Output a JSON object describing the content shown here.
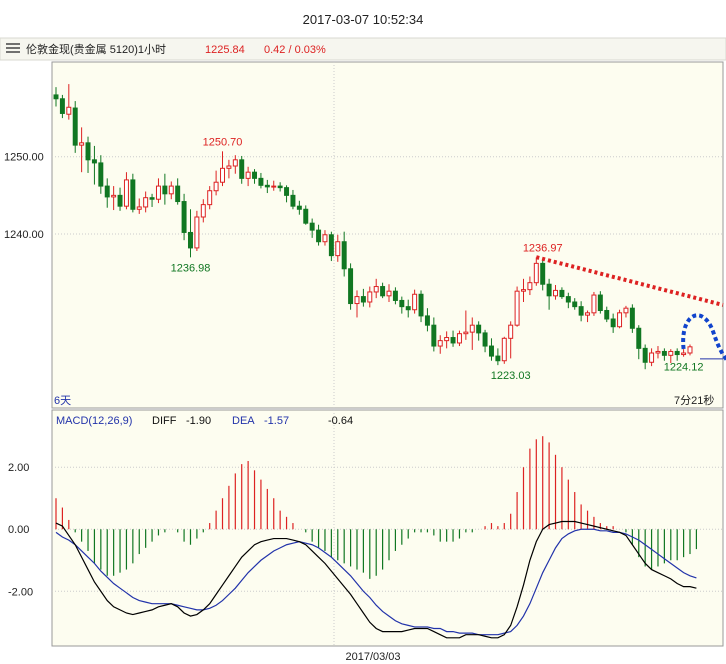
{
  "header": {
    "timestamp": "2017-03-07 10:52:34",
    "instrument": "伦敦金现(贵金属 5120)1小时",
    "price": "1225.84",
    "change": "0.42 / 0.03%"
  },
  "colors": {
    "up": "#dd2222",
    "down": "#117722",
    "grid": "#cccccc",
    "panel_bg": "#fdfdf0",
    "diff_line": "#000000",
    "dea_line": "#2233aa",
    "trend_line": "#dd2222",
    "forecast_arrow": "#1144cc"
  },
  "chart_data": [
    {
      "type": "candlestick",
      "ylim": [
        1218,
        1262
      ],
      "yticks": [
        1240.0,
        1250.0
      ],
      "ytick_labels": [
        "1240.00",
        "1250.00"
      ],
      "period_label": "6天",
      "countdown_label": "7分21秒",
      "x_label": "2017/03/03",
      "annotations": [
        {
          "label": "1250.70",
          "bar": 26,
          "value": 1250.7,
          "color": "up"
        },
        {
          "label": "1236.98",
          "bar": 21,
          "value": 1236.98,
          "color": "down"
        },
        {
          "label": "1223.03",
          "bar": 71,
          "value": 1223.03,
          "color": "down"
        },
        {
          "label": "1236.97",
          "bar": 76,
          "value": 1236.97,
          "color": "up"
        },
        {
          "label": "1224.12",
          "bar": 98,
          "value": 1224.12,
          "color": "down"
        }
      ],
      "trendline": {
        "from": {
          "bar": 75,
          "value": 1237.0
        },
        "to": {
          "bar": 100,
          "value": 1231.7
        }
      },
      "forecast": {
        "bar_start": 98,
        "value_start": 1224.6
      },
      "candles": [
        [
          1258,
          1259,
          1256.5,
          1257.5
        ],
        [
          1257.5,
          1258,
          1255,
          1255.6
        ],
        [
          1255.5,
          1259.4,
          1254.8,
          1256.4
        ],
        [
          1256.3,
          1257.2,
          1250.5,
          1251.5
        ],
        [
          1251.5,
          1253.8,
          1248,
          1251.8
        ],
        [
          1251.8,
          1252.6,
          1247.9,
          1249.6
        ],
        [
          1249.6,
          1251.4,
          1246.4,
          1249.2
        ],
        [
          1249.2,
          1250.2,
          1245.2,
          1246.2
        ],
        [
          1246.2,
          1247.2,
          1243.4,
          1244.8
        ],
        [
          1244.8,
          1246.2,
          1243.1,
          1245
        ],
        [
          1245,
          1246,
          1243,
          1243.6
        ],
        [
          1243.6,
          1248,
          1243.2,
          1247
        ],
        [
          1247,
          1247.8,
          1242.8,
          1243.2
        ],
        [
          1243.2,
          1244.6,
          1242.6,
          1243.5
        ],
        [
          1243.5,
          1245.5,
          1242.8,
          1244.7
        ],
        [
          1244.7,
          1245.2,
          1243.5,
          1244.5
        ],
        [
          1244.5,
          1247.2,
          1244,
          1246.2
        ],
        [
          1246.2,
          1247.8,
          1243.8,
          1245.2
        ],
        [
          1245.2,
          1246.8,
          1244.5,
          1246.2
        ],
        [
          1246.2,
          1247.2,
          1243.8,
          1244.2
        ],
        [
          1244.2,
          1245.2,
          1239.2,
          1240.2
        ],
        [
          1240.2,
          1243.2,
          1236.98,
          1238.2
        ],
        [
          1238.2,
          1243,
          1237.8,
          1242.2
        ],
        [
          1242.2,
          1244.5,
          1241.5,
          1243.8
        ],
        [
          1243.8,
          1246.2,
          1243.2,
          1245.6
        ],
        [
          1245.6,
          1248.2,
          1245,
          1246.7
        ],
        [
          1246.7,
          1250.7,
          1246.2,
          1248.5
        ],
        [
          1248.5,
          1249.6,
          1247.2,
          1248.8
        ],
        [
          1248.8,
          1250.2,
          1247.8,
          1249.6
        ],
        [
          1249.6,
          1250.1,
          1246.5,
          1247.2
        ],
        [
          1247.2,
          1248.7,
          1246.2,
          1248
        ],
        [
          1248,
          1248.4,
          1246.5,
          1247.2
        ],
        [
          1247.2,
          1247.9,
          1245.9,
          1246.3
        ],
        [
          1246.3,
          1247,
          1245.3,
          1246.1
        ],
        [
          1246.1,
          1246.9,
          1245.6,
          1246.2
        ],
        [
          1246.2,
          1246.7,
          1245.5,
          1246.0
        ],
        [
          1246.0,
          1246.3,
          1244.1,
          1245
        ],
        [
          1245,
          1245.7,
          1243.2,
          1243.6
        ],
        [
          1243.6,
          1244.3,
          1242.5,
          1243.2
        ],
        [
          1243.2,
          1243.7,
          1241.2,
          1241.4
        ],
        [
          1241.4,
          1242,
          1239.5,
          1240.5
        ],
        [
          1240.5,
          1241.2,
          1238.5,
          1239
        ],
        [
          1239,
          1240.5,
          1238.5,
          1239.9
        ],
        [
          1239.9,
          1240.3,
          1236.5,
          1237.2
        ],
        [
          1237.2,
          1239.9,
          1236.4,
          1239
        ],
        [
          1239,
          1240.3,
          1234.5,
          1235.5
        ],
        [
          1235.5,
          1236.2,
          1230.2,
          1231
        ],
        [
          1231,
          1232.7,
          1229.2,
          1231.9
        ],
        [
          1231.9,
          1232.9,
          1230.6,
          1231.2
        ],
        [
          1231.2,
          1233.2,
          1230.5,
          1232.5
        ],
        [
          1232.5,
          1234.2,
          1231.7,
          1233.2
        ],
        [
          1233.2,
          1233.7,
          1231.7,
          1232
        ],
        [
          1232,
          1233.5,
          1231.2,
          1232.6
        ],
        [
          1232.6,
          1233.1,
          1230.9,
          1231.4
        ],
        [
          1231.4,
          1231.9,
          1229.7,
          1230.6
        ],
        [
          1230.6,
          1231.5,
          1229.2,
          1230.2
        ],
        [
          1230.2,
          1232.8,
          1229.7,
          1232.2
        ],
        [
          1232.2,
          1232.7,
          1228.6,
          1229.4
        ],
        [
          1229.4,
          1230.4,
          1227.4,
          1228.2
        ],
        [
          1228.2,
          1229.2,
          1224.8,
          1225.5
        ],
        [
          1225.5,
          1226.9,
          1224.5,
          1226.2
        ],
        [
          1226.2,
          1227.4,
          1225.2,
          1226.6
        ],
        [
          1226.6,
          1227.5,
          1225.4,
          1225.9
        ],
        [
          1225.9,
          1227.5,
          1225.5,
          1227.1
        ],
        [
          1227.1,
          1230.1,
          1226.3,
          1227.3
        ],
        [
          1227.3,
          1229.2,
          1225,
          1228.2
        ],
        [
          1228.2,
          1228.7,
          1226.2,
          1227.2
        ],
        [
          1227.2,
          1227.6,
          1224.7,
          1225.5
        ],
        [
          1225.5,
          1226.5,
          1223.6,
          1224.2
        ],
        [
          1224.2,
          1225.2,
          1223.03,
          1223.6
        ],
        [
          1223.6,
          1226.7,
          1223.2,
          1226.5
        ],
        [
          1226.5,
          1228.7,
          1223.9,
          1228.2
        ],
        [
          1228.2,
          1233.2,
          1228,
          1232.6
        ],
        [
          1232.6,
          1234.2,
          1231.2,
          1232.8
        ],
        [
          1232.8,
          1234.5,
          1232.1,
          1233.7
        ],
        [
          1233.7,
          1236.97,
          1233.3,
          1236.2
        ],
        [
          1236.2,
          1236.7,
          1232.7,
          1233.5
        ],
        [
          1233.5,
          1234.2,
          1230.2,
          1232
        ],
        [
          1232,
          1233.4,
          1231.5,
          1232.7
        ],
        [
          1232.7,
          1233.1,
          1231.6,
          1231.9
        ],
        [
          1231.9,
          1232.4,
          1230.4,
          1231.2
        ],
        [
          1231.2,
          1231.7,
          1230.2,
          1230.6
        ],
        [
          1230.6,
          1231.3,
          1228.7,
          1229.5
        ],
        [
          1229.5,
          1230.1,
          1228.6,
          1229.8
        ],
        [
          1229.8,
          1232.5,
          1229.4,
          1232.1
        ],
        [
          1232.1,
          1232.6,
          1229.7,
          1230.1
        ],
        [
          1230.1,
          1230.6,
          1228.6,
          1229
        ],
        [
          1229,
          1229.7,
          1227.2,
          1228
        ],
        [
          1228,
          1230.2,
          1227.8,
          1229.8
        ],
        [
          1229.8,
          1230.7,
          1229.2,
          1230.4
        ],
        [
          1230.4,
          1230.9,
          1227.2,
          1227.8
        ],
        [
          1227.8,
          1228.2,
          1223.8,
          1225.2
        ],
        [
          1225.2,
          1225.7,
          1222.5,
          1223.4
        ],
        [
          1223.4,
          1225.2,
          1222.9,
          1224.6
        ],
        [
          1224.6,
          1225.5,
          1223.9,
          1224.8
        ],
        [
          1224.8,
          1225.2,
          1223.6,
          1224.3
        ],
        [
          1224.3,
          1225.1,
          1223.3,
          1224.8
        ],
        [
          1224.8,
          1225.2,
          1223.6,
          1224.4
        ],
        [
          1224.4,
          1225.1,
          1224.12,
          1224.6
        ],
        [
          1224.6,
          1225.7,
          1224.3,
          1225.4
        ]
      ]
    },
    {
      "type": "macd",
      "label": "MACD(12,26,9)",
      "diff_label": "DIFF",
      "diff_value": "-1.90",
      "dea_label": "DEA",
      "dea_value": "-1.57",
      "hist_value": "-0.64",
      "ylim": [
        -3.7,
        3.2
      ],
      "yticks": [
        2.0,
        0.0,
        -2.0
      ],
      "ytick_labels": [
        "2.00",
        "0.00",
        "-2.00"
      ],
      "diff": [
        0.2,
        0.1,
        -0.2,
        -0.5,
        -0.9,
        -1.3,
        -1.7,
        -2.0,
        -2.3,
        -2.5,
        -2.6,
        -2.7,
        -2.75,
        -2.7,
        -2.65,
        -2.6,
        -2.5,
        -2.45,
        -2.4,
        -2.5,
        -2.7,
        -2.8,
        -2.75,
        -2.6,
        -2.4,
        -2.1,
        -1.8,
        -1.5,
        -1.2,
        -0.9,
        -0.7,
        -0.5,
        -0.4,
        -0.35,
        -0.3,
        -0.3,
        -0.3,
        -0.35,
        -0.4,
        -0.5,
        -0.7,
        -0.9,
        -1.1,
        -1.35,
        -1.6,
        -1.85,
        -2.1,
        -2.4,
        -2.7,
        -3.0,
        -3.2,
        -3.3,
        -3.3,
        -3.3,
        -3.3,
        -3.25,
        -3.2,
        -3.2,
        -3.2,
        -3.3,
        -3.4,
        -3.5,
        -3.5,
        -3.5,
        -3.4,
        -3.4,
        -3.4,
        -3.45,
        -3.5,
        -3.5,
        -3.4,
        -3.1,
        -2.5,
        -1.8,
        -1.0,
        -0.4,
        0.0,
        0.15,
        0.2,
        0.25,
        0.25,
        0.25,
        0.2,
        0.15,
        0.1,
        0.05,
        0.0,
        -0.05,
        -0.1,
        -0.2,
        -0.5,
        -0.8,
        -1.1,
        -1.3,
        -1.4,
        -1.5,
        -1.6,
        -1.75,
        -1.85,
        -1.85,
        -1.9
      ],
      "dea": [
        -0.1,
        -0.25,
        -0.35,
        -0.5,
        -0.7,
        -0.9,
        -1.1,
        -1.35,
        -1.55,
        -1.75,
        -1.9,
        -2.05,
        -2.2,
        -2.3,
        -2.35,
        -2.4,
        -2.4,
        -2.4,
        -2.4,
        -2.45,
        -2.5,
        -2.55,
        -2.6,
        -2.6,
        -2.55,
        -2.45,
        -2.3,
        -2.1,
        -1.9,
        -1.65,
        -1.4,
        -1.2,
        -1.0,
        -0.85,
        -0.7,
        -0.6,
        -0.5,
        -0.45,
        -0.4,
        -0.45,
        -0.5,
        -0.6,
        -0.75,
        -0.9,
        -1.1,
        -1.3,
        -1.5,
        -1.75,
        -2.0,
        -2.2,
        -2.45,
        -2.65,
        -2.8,
        -2.95,
        -3.05,
        -3.1,
        -3.15,
        -3.15,
        -3.15,
        -3.2,
        -3.2,
        -3.3,
        -3.3,
        -3.35,
        -3.35,
        -3.35,
        -3.4,
        -3.4,
        -3.4,
        -3.4,
        -3.35,
        -3.3,
        -3.1,
        -2.8,
        -2.4,
        -1.9,
        -1.4,
        -1.0,
        -0.6,
        -0.3,
        -0.15,
        -0.05,
        0.0,
        0.0,
        0.0,
        -0.05,
        -0.05,
        -0.1,
        -0.1,
        -0.15,
        -0.25,
        -0.35,
        -0.5,
        -0.65,
        -0.8,
        -0.95,
        -1.1,
        -1.25,
        -1.4,
        -1.5,
        -1.57
      ],
      "hist": [
        1.0,
        0.7,
        0.3,
        -0.1,
        -0.4,
        -0.7,
        -1.1,
        -1.3,
        -1.5,
        -1.5,
        -1.4,
        -1.3,
        -1.1,
        -0.8,
        -0.6,
        -0.4,
        -0.2,
        -0.1,
        0.0,
        -0.1,
        -0.4,
        -0.5,
        -0.3,
        -0.1,
        0.2,
        0.6,
        1.0,
        1.4,
        1.8,
        2.1,
        2.2,
        1.9,
        1.6,
        1.3,
        1.0,
        0.6,
        0.4,
        0.2,
        0.0,
        -0.1,
        -0.4,
        -0.6,
        -0.7,
        -0.9,
        -1.0,
        -1.1,
        -1.2,
        -1.3,
        -1.4,
        -1.6,
        -1.5,
        -1.3,
        -1.0,
        -0.7,
        -0.5,
        -0.3,
        -0.1,
        -0.1,
        -0.1,
        -0.2,
        -0.4,
        -0.4,
        -0.4,
        -0.3,
        -0.1,
        -0.1,
        0.0,
        0.1,
        0.2,
        0.1,
        0.2,
        0.5,
        1.2,
        2.0,
        2.6,
        2.9,
        3.0,
        2.8,
        2.4,
        2.0,
        1.6,
        1.2,
        0.8,
        0.6,
        0.4,
        0.2,
        0.1,
        0.1,
        0.0,
        -0.1,
        -0.5,
        -0.9,
        -1.2,
        -1.3,
        -1.2,
        -1.1,
        -1.0,
        -1.0,
        -0.9,
        -0.8,
        -0.64
      ]
    }
  ]
}
